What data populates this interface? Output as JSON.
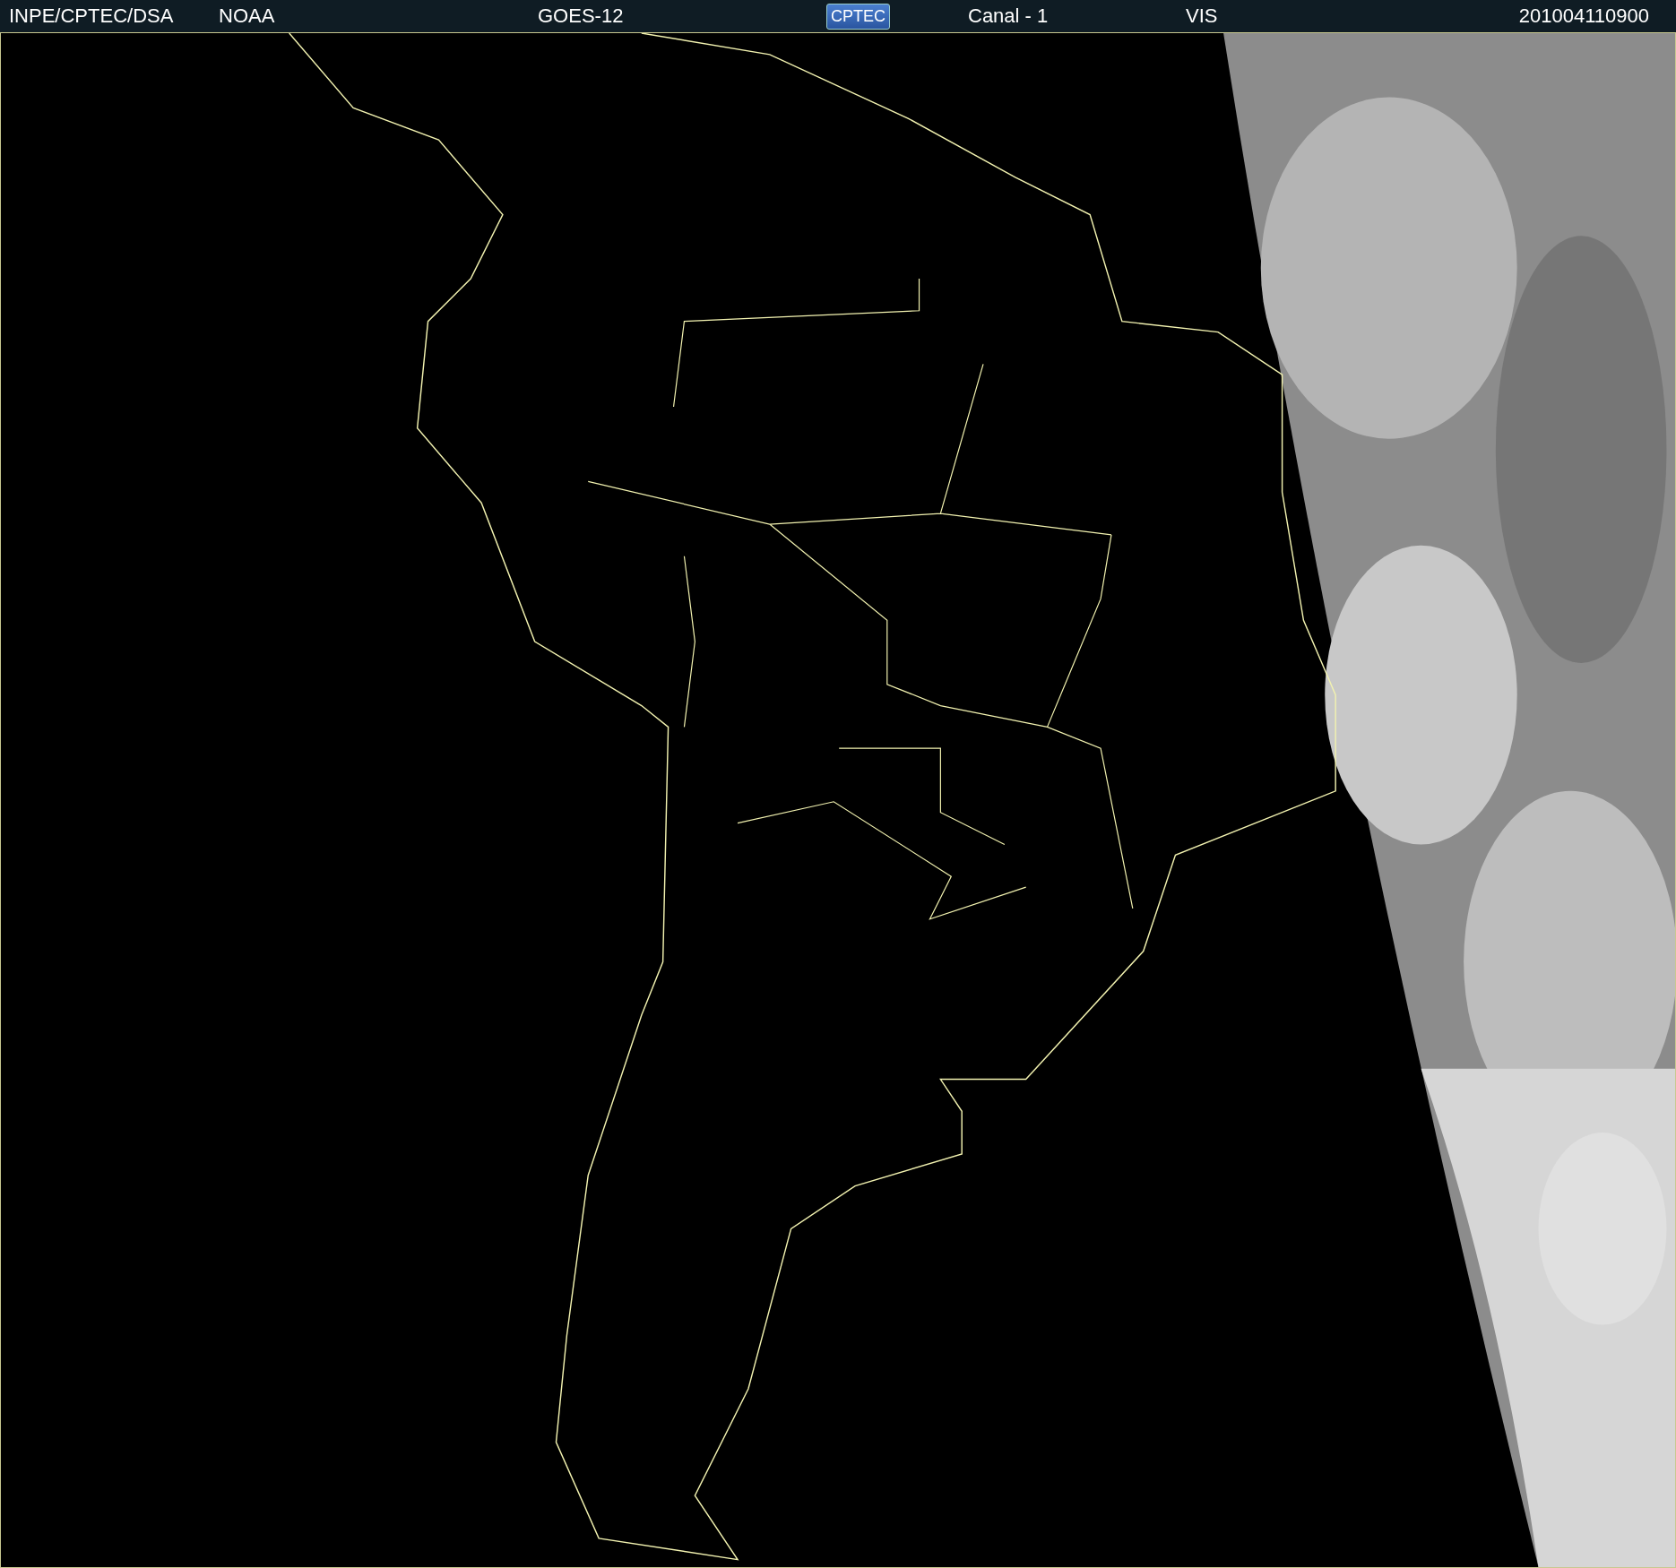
{
  "header": {
    "source": "INPE/CPTEC/DSA",
    "agency": "NOAA",
    "satellite": "GOES-12",
    "logo": "CPTEC",
    "channel": "Canal - 1",
    "band": "VIS",
    "timestamp": "201004110900"
  }
}
